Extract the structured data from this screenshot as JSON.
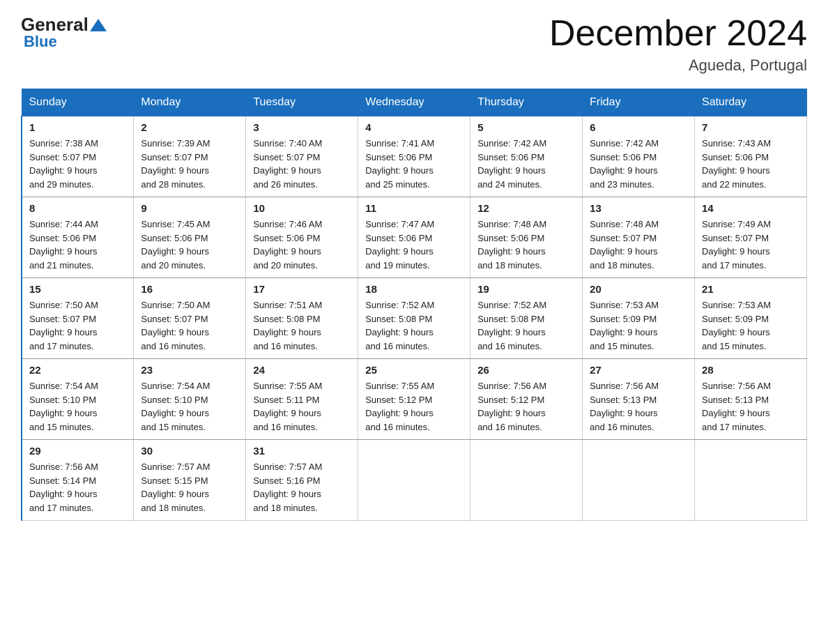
{
  "logo": {
    "general": "General",
    "blue": "Blue"
  },
  "header": {
    "title": "December 2024",
    "subtitle": "Agueda, Portugal"
  },
  "weekdays": [
    "Sunday",
    "Monday",
    "Tuesday",
    "Wednesday",
    "Thursday",
    "Friday",
    "Saturday"
  ],
  "weeks": [
    [
      {
        "day": "1",
        "sunrise": "7:38 AM",
        "sunset": "5:07 PM",
        "daylight": "9 hours and 29 minutes."
      },
      {
        "day": "2",
        "sunrise": "7:39 AM",
        "sunset": "5:07 PM",
        "daylight": "9 hours and 28 minutes."
      },
      {
        "day": "3",
        "sunrise": "7:40 AM",
        "sunset": "5:07 PM",
        "daylight": "9 hours and 26 minutes."
      },
      {
        "day": "4",
        "sunrise": "7:41 AM",
        "sunset": "5:06 PM",
        "daylight": "9 hours and 25 minutes."
      },
      {
        "day": "5",
        "sunrise": "7:42 AM",
        "sunset": "5:06 PM",
        "daylight": "9 hours and 24 minutes."
      },
      {
        "day": "6",
        "sunrise": "7:42 AM",
        "sunset": "5:06 PM",
        "daylight": "9 hours and 23 minutes."
      },
      {
        "day": "7",
        "sunrise": "7:43 AM",
        "sunset": "5:06 PM",
        "daylight": "9 hours and 22 minutes."
      }
    ],
    [
      {
        "day": "8",
        "sunrise": "7:44 AM",
        "sunset": "5:06 PM",
        "daylight": "9 hours and 21 minutes."
      },
      {
        "day": "9",
        "sunrise": "7:45 AM",
        "sunset": "5:06 PM",
        "daylight": "9 hours and 20 minutes."
      },
      {
        "day": "10",
        "sunrise": "7:46 AM",
        "sunset": "5:06 PM",
        "daylight": "9 hours and 20 minutes."
      },
      {
        "day": "11",
        "sunrise": "7:47 AM",
        "sunset": "5:06 PM",
        "daylight": "9 hours and 19 minutes."
      },
      {
        "day": "12",
        "sunrise": "7:48 AM",
        "sunset": "5:06 PM",
        "daylight": "9 hours and 18 minutes."
      },
      {
        "day": "13",
        "sunrise": "7:48 AM",
        "sunset": "5:07 PM",
        "daylight": "9 hours and 18 minutes."
      },
      {
        "day": "14",
        "sunrise": "7:49 AM",
        "sunset": "5:07 PM",
        "daylight": "9 hours and 17 minutes."
      }
    ],
    [
      {
        "day": "15",
        "sunrise": "7:50 AM",
        "sunset": "5:07 PM",
        "daylight": "9 hours and 17 minutes."
      },
      {
        "day": "16",
        "sunrise": "7:50 AM",
        "sunset": "5:07 PM",
        "daylight": "9 hours and 16 minutes."
      },
      {
        "day": "17",
        "sunrise": "7:51 AM",
        "sunset": "5:08 PM",
        "daylight": "9 hours and 16 minutes."
      },
      {
        "day": "18",
        "sunrise": "7:52 AM",
        "sunset": "5:08 PM",
        "daylight": "9 hours and 16 minutes."
      },
      {
        "day": "19",
        "sunrise": "7:52 AM",
        "sunset": "5:08 PM",
        "daylight": "9 hours and 16 minutes."
      },
      {
        "day": "20",
        "sunrise": "7:53 AM",
        "sunset": "5:09 PM",
        "daylight": "9 hours and 15 minutes."
      },
      {
        "day": "21",
        "sunrise": "7:53 AM",
        "sunset": "5:09 PM",
        "daylight": "9 hours and 15 minutes."
      }
    ],
    [
      {
        "day": "22",
        "sunrise": "7:54 AM",
        "sunset": "5:10 PM",
        "daylight": "9 hours and 15 minutes."
      },
      {
        "day": "23",
        "sunrise": "7:54 AM",
        "sunset": "5:10 PM",
        "daylight": "9 hours and 15 minutes."
      },
      {
        "day": "24",
        "sunrise": "7:55 AM",
        "sunset": "5:11 PM",
        "daylight": "9 hours and 16 minutes."
      },
      {
        "day": "25",
        "sunrise": "7:55 AM",
        "sunset": "5:12 PM",
        "daylight": "9 hours and 16 minutes."
      },
      {
        "day": "26",
        "sunrise": "7:56 AM",
        "sunset": "5:12 PM",
        "daylight": "9 hours and 16 minutes."
      },
      {
        "day": "27",
        "sunrise": "7:56 AM",
        "sunset": "5:13 PM",
        "daylight": "9 hours and 16 minutes."
      },
      {
        "day": "28",
        "sunrise": "7:56 AM",
        "sunset": "5:13 PM",
        "daylight": "9 hours and 17 minutes."
      }
    ],
    [
      {
        "day": "29",
        "sunrise": "7:56 AM",
        "sunset": "5:14 PM",
        "daylight": "9 hours and 17 minutes."
      },
      {
        "day": "30",
        "sunrise": "7:57 AM",
        "sunset": "5:15 PM",
        "daylight": "9 hours and 18 minutes."
      },
      {
        "day": "31",
        "sunrise": "7:57 AM",
        "sunset": "5:16 PM",
        "daylight": "9 hours and 18 minutes."
      },
      null,
      null,
      null,
      null
    ]
  ],
  "labels": {
    "sunrise": "Sunrise:",
    "sunset": "Sunset:",
    "daylight": "Daylight:"
  }
}
